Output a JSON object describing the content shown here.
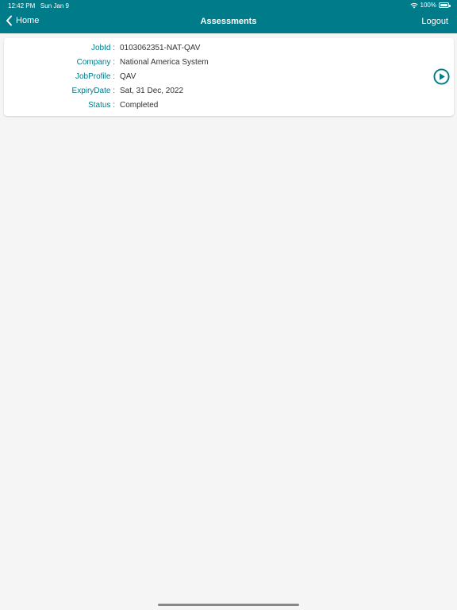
{
  "status_bar": {
    "time": "12:42 PM",
    "date": "Sun Jan 9",
    "battery": "100%"
  },
  "nav": {
    "back_label": "Home",
    "title": "Assessments",
    "logout_label": "Logout"
  },
  "assessment": {
    "rows": [
      {
        "label": "JobId :",
        "value": "0103062351-NAT-QAV"
      },
      {
        "label": "Company :",
        "value": "National America System"
      },
      {
        "label": "JobProfile :",
        "value": "QAV"
      },
      {
        "label": "ExpiryDate :",
        "value": "Sat, 31 Dec, 2022"
      },
      {
        "label": "Status :",
        "value": "Completed"
      }
    ]
  },
  "colors": {
    "accent": "#007b8a",
    "background": "#f5f5f5"
  },
  "icons": {
    "back": "chevron-left-icon",
    "play": "play-circle-icon",
    "wifi": "wifi-icon",
    "battery": "battery-icon"
  }
}
